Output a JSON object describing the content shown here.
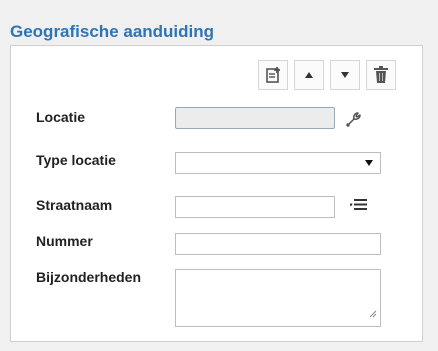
{
  "panel": {
    "title": "Geografische aanduiding"
  },
  "toolbar": {
    "buttons": [
      {
        "name": "add",
        "icon": "add-document-icon"
      },
      {
        "name": "move-up",
        "icon": "caret-up-icon"
      },
      {
        "name": "move-down",
        "icon": "caret-down-icon"
      },
      {
        "name": "delete",
        "icon": "trash-icon"
      }
    ]
  },
  "form": {
    "locatie": {
      "label": "Locatie",
      "value": "",
      "icon": "wrench-icon"
    },
    "type_locatie": {
      "label": "Type locatie",
      "selected": ""
    },
    "straatnaam": {
      "label": "Straatnaam",
      "value": "",
      "icon": "list-icon"
    },
    "nummer": {
      "label": "Nummer",
      "value": ""
    },
    "bijzonderheden": {
      "label": "Bijzonderheden",
      "value": ""
    }
  },
  "colors": {
    "title": "#2f74b5",
    "panel_border": "#cfcfcf",
    "field_border": "#bdbdbd",
    "disabled_field_bg": "#ececec"
  }
}
